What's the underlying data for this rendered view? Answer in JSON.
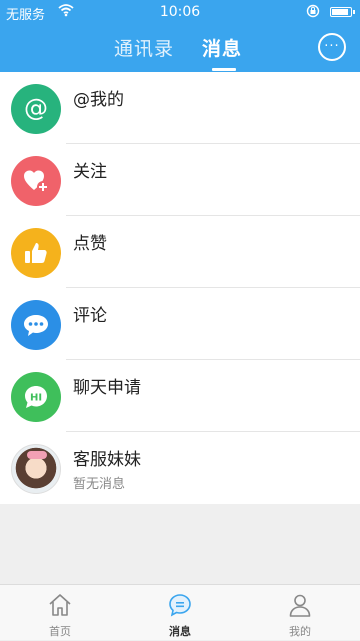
{
  "status_bar": {
    "carrier": "无服务",
    "time": "10:06"
  },
  "header": {
    "tabs": [
      {
        "label": "通讯录"
      },
      {
        "label": "消息"
      }
    ],
    "active_tab": "消息",
    "chat_icon": "chat-bubble-icon"
  },
  "messages": {
    "items": [
      {
        "title": "@我的",
        "icon": "at-icon",
        "color": "#27b37d"
      },
      {
        "title": "关注",
        "icon": "heart-plus-icon",
        "color": "#f0626a"
      },
      {
        "title": "点赞",
        "icon": "thumbs-up-icon",
        "color": "#f5b21c"
      },
      {
        "title": "评论",
        "icon": "comment-icon",
        "color": "#2b8fe6"
      },
      {
        "title": "聊天申请",
        "icon": "hi-bubble-icon",
        "color": "#3fbf5b"
      },
      {
        "title": "客服妹妹",
        "subtitle": "暂无消息",
        "icon": "avatar"
      }
    ]
  },
  "tab_bar": {
    "items": [
      {
        "label": "首页",
        "icon": "home-icon"
      },
      {
        "label": "消息",
        "icon": "message-icon"
      },
      {
        "label": "我的",
        "icon": "profile-icon"
      }
    ],
    "active": "消息"
  },
  "colors": {
    "header_bg": "#3aa5ee",
    "background": "#efefef"
  }
}
